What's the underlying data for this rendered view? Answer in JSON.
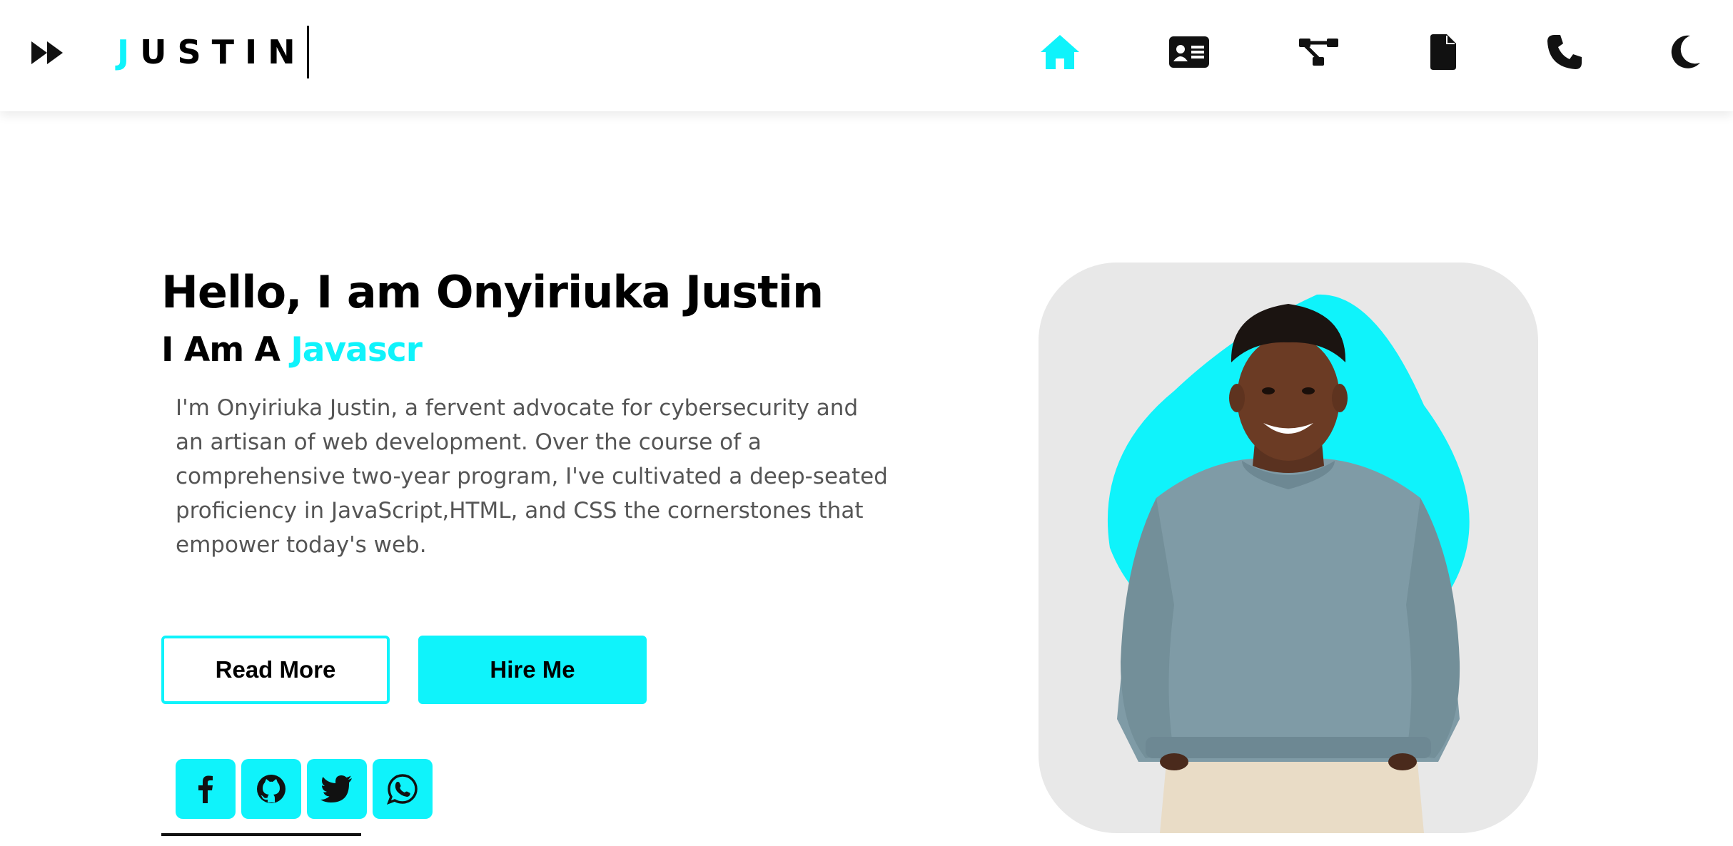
{
  "header": {
    "logo_first_letter": "J",
    "logo_rest": "USTIN",
    "nav": [
      {
        "icon": "home-icon",
        "active": true
      },
      {
        "icon": "id-card-icon",
        "active": false
      },
      {
        "icon": "sitemap-icon",
        "active": false
      },
      {
        "icon": "file-icon",
        "active": false
      },
      {
        "icon": "phone-icon",
        "active": false
      },
      {
        "icon": "moon-icon",
        "active": false
      }
    ],
    "menu_icon": "fast-forward-icon"
  },
  "hero": {
    "title": "Hello, I am Onyiriuka Justin",
    "subtitle_prefix": "I Am A ",
    "subtitle_typed": "Javascr",
    "description": "I'm Onyiriuka Justin, a fervent advocate for cybersecurity and an artisan of web development. Over the course of a comprehensive two-year program, I've cultivated a deep-seated proficiency in JavaScript,HTML, and CSS the cornerstones that empower today's web.",
    "read_more_label": "Read More",
    "hire_me_label": "Hire Me"
  },
  "socials": [
    {
      "icon": "facebook-icon"
    },
    {
      "icon": "github-icon"
    },
    {
      "icon": "twitter-icon"
    },
    {
      "icon": "whatsapp-icon"
    }
  ],
  "colors": {
    "accent": "#0ff3fb",
    "text": "#000000",
    "muted_text": "#555555",
    "card_bg": "#e8e8e8"
  }
}
